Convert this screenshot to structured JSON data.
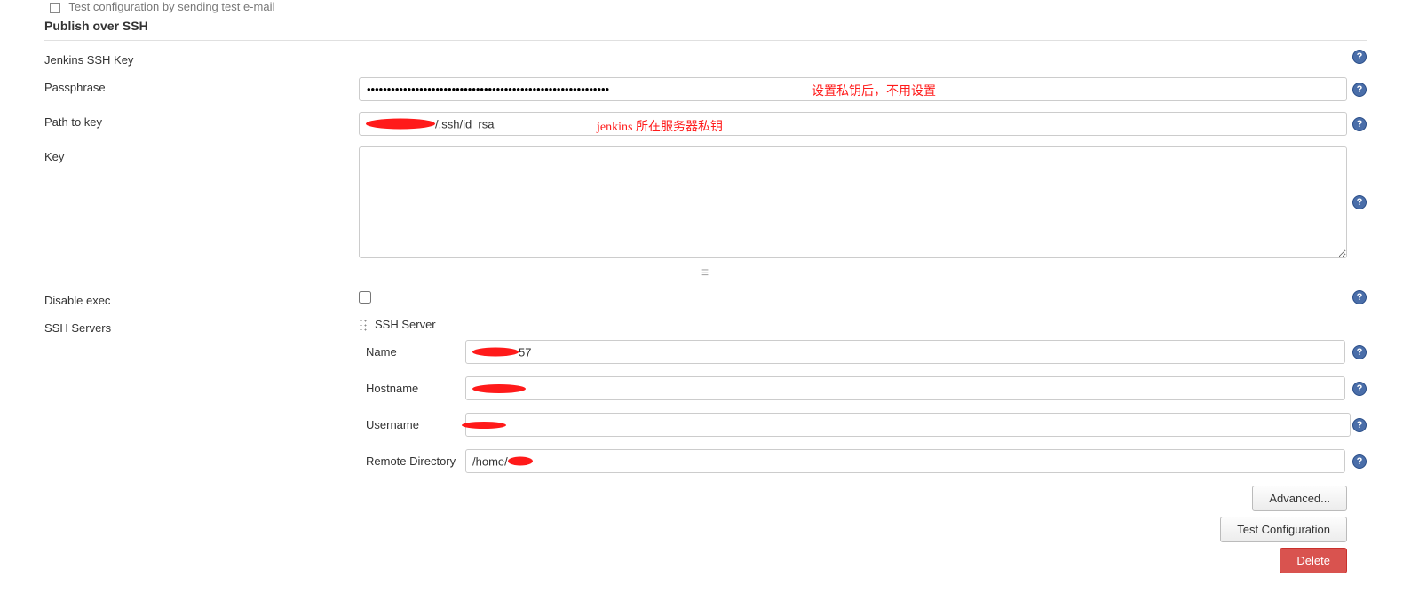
{
  "top_partial_text": "Test configuration by sending test e-mail",
  "section_title": "Publish over SSH",
  "rows": {
    "jenkins_ssh_key_label": "Jenkins SSH Key",
    "passphrase_label": "Passphrase",
    "passphrase_value": "●●●●●●●●●●●●●●●●●●●●●●●●●●●●●●●●●●●●●●●●●●●●●●●●●●●●●●●●●●●●",
    "passphrase_annotation": "设置私钥后，不用设置",
    "path_label": "Path to key",
    "path_suffix": "/.ssh/id_rsa",
    "path_annotation": "jenkins 所在服务器私钥",
    "key_label": "Key",
    "disable_exec_label": "Disable exec",
    "ssh_servers_label": "SSH Servers"
  },
  "ssh_server": {
    "header": "SSH Server",
    "name_label": "Name",
    "name_suffix": "57",
    "hostname_label": "Hostname",
    "username_label": "Username",
    "remote_dir_label": "Remote Directory",
    "remote_dir_value": "/home/"
  },
  "buttons": {
    "advanced": "Advanced...",
    "test_config": "Test Configuration",
    "delete": "Delete"
  }
}
